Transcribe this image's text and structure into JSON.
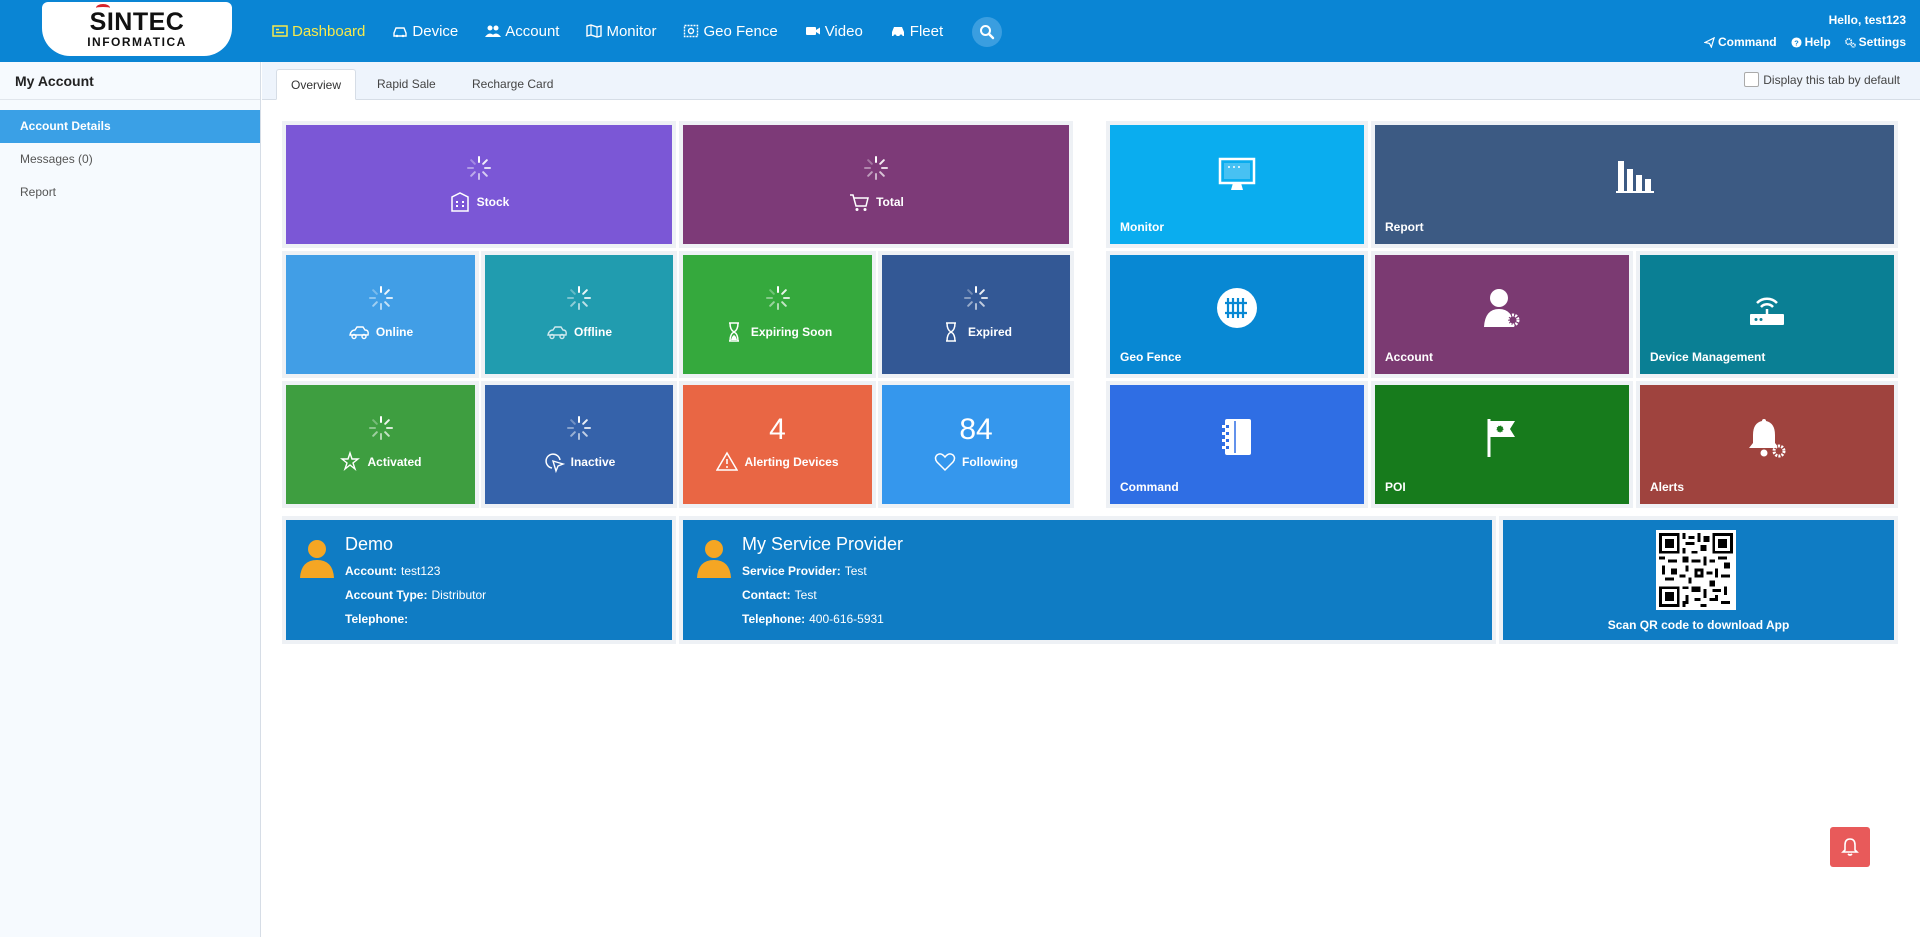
{
  "header": {
    "logo_top": "SINTEC",
    "logo_bottom": "INFORMATICA",
    "nav": [
      {
        "label": "Dashboard",
        "icon": "dashboard-icon"
      },
      {
        "label": "Device",
        "icon": "car-icon"
      },
      {
        "label": "Account",
        "icon": "users-icon"
      },
      {
        "label": "Monitor",
        "icon": "map-icon"
      },
      {
        "label": "Geo Fence",
        "icon": "fence-icon"
      },
      {
        "label": "Video",
        "icon": "video-icon"
      },
      {
        "label": "Fleet",
        "icon": "fleet-icon"
      }
    ],
    "hello": "Hello,   test123",
    "links": {
      "command": "Command",
      "help": "Help",
      "settings": "Settings"
    }
  },
  "sidebar": {
    "title": "My Account",
    "items": [
      {
        "label": "Account Details"
      },
      {
        "label": "Messages (0)"
      },
      {
        "label": "Report"
      }
    ]
  },
  "tabs": {
    "items": [
      {
        "label": "Overview"
      },
      {
        "label": "Rapid Sale"
      },
      {
        "label": "Recharge Card"
      }
    ],
    "default_label": "Display this tab by default"
  },
  "stats": {
    "stock": "Stock",
    "total": "Total",
    "online": "Online",
    "offline": "Offline",
    "expiring": "Expiring Soon",
    "expired": "Expired",
    "activated": "Activated",
    "inactive": "Inactive",
    "alerting": {
      "label": "Alerting Devices",
      "value": "4"
    },
    "following": {
      "label": "Following",
      "value": "84"
    }
  },
  "shortcuts": {
    "monitor": "Monitor",
    "report": "Report",
    "geofence": "Geo Fence",
    "account": "Account",
    "device_mgmt": "Device Management",
    "command": "Command",
    "poi": "POI",
    "alerts": "Alerts"
  },
  "account_card": {
    "title": "Demo",
    "account_label": "Account:",
    "account_value": "test123",
    "type_label": "Account Type:",
    "type_value": "Distributor",
    "tel_label": "Telephone:",
    "tel_value": ""
  },
  "provider_card": {
    "title": "My Service Provider",
    "provider_label": "Service Provider:",
    "provider_value": "Test",
    "contact_label": "Contact:",
    "contact_value": "Test",
    "tel_label": "Telephone:",
    "tel_value": "400-616-5931"
  },
  "qr_card": {
    "label": "Scan QR code to download App"
  },
  "colors": {
    "header": "#0a85d4",
    "stock": "#7b57d6",
    "total": "#7d3a78",
    "online": "#419ee6",
    "offline": "#219caf",
    "expiring": "#35a93d",
    "expired": "#335895",
    "activated": "#3e9e40",
    "inactive": "#3562aa",
    "alerting": "#e96644",
    "following": "#3597ed",
    "monitor": "#0aadef",
    "report": "#3c5a83",
    "geofence": "#0888d3",
    "account": "#7b3a72",
    "device_mgmt": "#0a7f94",
    "command": "#2f6ee4",
    "poi": "#177b1c",
    "alerts": "#9f433e"
  }
}
